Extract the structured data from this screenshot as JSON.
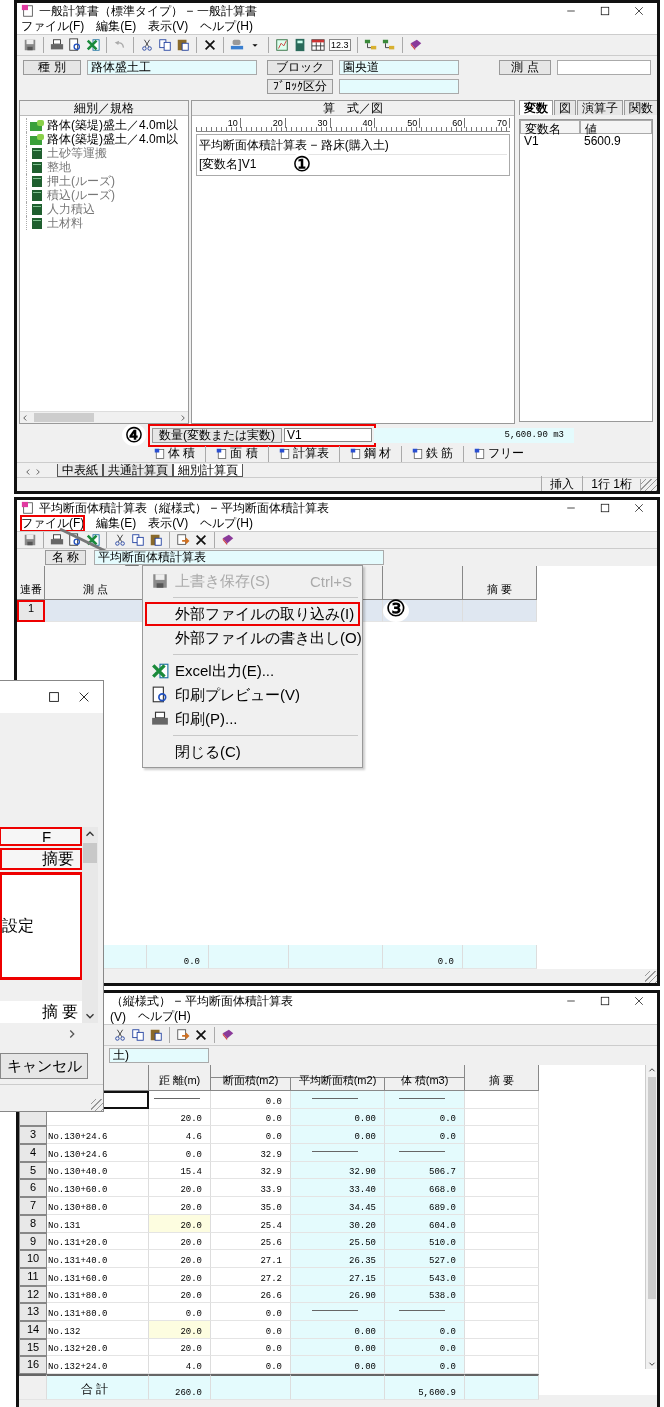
{
  "window_a": {
    "title": "一般計算書（標準タイプ） − 一般計算書",
    "menu": [
      "ファイル(F)",
      "編集(E)",
      "表示(V)",
      "ヘルプ(H)"
    ],
    "toolbar": [
      {
        "kind": "save"
      },
      {
        "kind": "sep"
      },
      {
        "kind": "print"
      },
      {
        "kind": "preview"
      },
      {
        "kind": "excel"
      },
      {
        "kind": "sep"
      },
      {
        "kind": "undo"
      },
      {
        "kind": "sep"
      },
      {
        "kind": "cut"
      },
      {
        "kind": "copy"
      },
      {
        "kind": "paste"
      },
      {
        "kind": "sep"
      },
      {
        "kind": "delete"
      },
      {
        "kind": "sep"
      },
      {
        "kind": "stamp"
      },
      {
        "kind": "caret"
      },
      {
        "kind": "sep"
      },
      {
        "kind": "chart"
      },
      {
        "kind": "calc"
      },
      {
        "kind": "grid"
      },
      {
        "kind": "label",
        "label": "12.3"
      },
      {
        "kind": "sep"
      },
      {
        "kind": "tree"
      },
      {
        "kind": "tree"
      },
      {
        "kind": "sep"
      },
      {
        "kind": "book"
      }
    ],
    "fields": [
      {
        "label": "種 別",
        "value": "路体盛土工"
      },
      {
        "label": "ブロック",
        "value": "園央道"
      },
      {
        "label": "ﾌﾞﾛｯｸ区分"
      },
      {
        "label": "測 点"
      }
    ],
    "tree_header": "細別／規格",
    "tree": [
      {
        "label": "路体(築堤)盛土／4.0m以",
        "kind": "group",
        "disabled": false
      },
      {
        "label": "路体(築堤)盛土／4.0m以",
        "kind": "group",
        "disabled": false
      },
      {
        "label": "土砂等運搬",
        "kind": "item",
        "disabled": true
      },
      {
        "label": "整地",
        "kind": "item",
        "disabled": true
      },
      {
        "label": "押土(ルーズ)",
        "kind": "item",
        "disabled": true
      },
      {
        "label": "積込(ルーズ)",
        "kind": "item",
        "disabled": true
      },
      {
        "label": "人力積込",
        "kind": "item",
        "disabled": true
      },
      {
        "label": "土材料",
        "kind": "item",
        "disabled": true
      }
    ],
    "formula_header": "算　式／図",
    "ruler_ticks": [
      "10",
      "20",
      "30",
      "40",
      "50",
      "60",
      "70"
    ],
    "formula_lines": [
      "平均断面体積計算表 − 路床(購入土)",
      "[変数名]V1"
    ],
    "formula_callout": "①",
    "side_tabs": [
      {
        "label": "変数",
        "selected": true
      },
      {
        "label": "図",
        "selected": false
      },
      {
        "label": "演算子",
        "selected": false
      },
      {
        "label": "関数",
        "selected": false
      }
    ],
    "variables": {
      "columns": [
        "変数名",
        "値"
      ],
      "rows": [
        [
          "V1",
          "5600.9"
        ]
      ]
    },
    "quantity": {
      "callout_number": "④",
      "label": "数量(変数または実数)",
      "value": "V1",
      "result": "5,600.90 m3",
      "callout": true
    },
    "insert_buttons": [
      "体 積",
      "面 積",
      "計算表",
      "鋼 材",
      "鉄 筋",
      "フリー"
    ],
    "sheet_tabs": [
      {
        "label": "中表紙",
        "selected": false
      },
      {
        "label": "共通計算頁",
        "selected": false
      },
      {
        "label": "細別計算頁",
        "selected": true
      }
    ],
    "status": [
      "挿入",
      "1行 1桁"
    ]
  },
  "window_b": {
    "title": "平均断面体積計算表（縦様式） − 平均断面体積計算表",
    "menu": [
      {
        "label": "ファイル(F)",
        "callout": true
      },
      {
        "label": "編集(E)",
        "callout": false
      },
      {
        "label": "表示(V)",
        "callout": false
      },
      {
        "label": "ヘルプ(H)",
        "callout": false
      }
    ],
    "toolbar": [
      {
        "kind": "save"
      },
      {
        "kind": "sep"
      },
      {
        "kind": "print"
      },
      {
        "kind": "preview"
      },
      {
        "kind": "excel"
      },
      {
        "kind": "sep"
      },
      {
        "kind": "cut"
      },
      {
        "kind": "copy"
      },
      {
        "kind": "paste"
      },
      {
        "kind": "sep"
      },
      {
        "kind": "import"
      },
      {
        "kind": "delete"
      },
      {
        "kind": "sep"
      },
      {
        "kind": "book"
      }
    ],
    "name_field": {
      "label": "名 称",
      "value": "平均断面体積計算表"
    },
    "columns": {
      "index": "連番",
      "station": "測 点",
      "summary": "摘 要"
    },
    "rows": [
      {
        "index": "1",
        "selected": true,
        "callout": true
      }
    ],
    "totals": {
      "distance": "0.0",
      "volume": "0.0"
    }
  },
  "file_menu": {
    "callout_number": "③",
    "items": [
      {
        "kind": "item",
        "label": "上書き保存(S)",
        "shortcut": "Ctrl+S",
        "disabled": true,
        "callout": false
      },
      {
        "kind": "separator"
      },
      {
        "kind": "item",
        "label": "外部ファイルの取り込み(I)",
        "disabled": false,
        "callout": true
      },
      {
        "kind": "item",
        "label": "外部ファイルの書き出し(O)",
        "disabled": false,
        "callout": false
      },
      {
        "kind": "separator"
      },
      {
        "kind": "item",
        "label": "Excel出力(E)...",
        "disabled": false,
        "callout": false
      },
      {
        "kind": "item",
        "label": "印刷プレビュー(V)",
        "disabled": false,
        "callout": false
      },
      {
        "kind": "item",
        "label": "印刷(P)...",
        "disabled": false,
        "callout": false
      },
      {
        "kind": "separator"
      },
      {
        "kind": "item",
        "label": "閉じる(C)",
        "disabled": false,
        "callout": false
      }
    ]
  },
  "dialog": {
    "header": "F",
    "header_callout": true,
    "subheader": "摘要",
    "subheader_callout": true,
    "body_text": "設定",
    "body_callout": true,
    "row_label": "摘 要",
    "button": "キャンセル"
  },
  "window_c": {
    "title": "（縦様式） − 平均断面体積計算表",
    "menu": [
      "(V)",
      "ヘルプ(H)"
    ],
    "toolbar": [
      {
        "kind": "cut"
      },
      {
        "kind": "copy"
      },
      {
        "kind": "paste"
      },
      {
        "kind": "sep"
      },
      {
        "kind": "import"
      },
      {
        "kind": "delete"
      },
      {
        "kind": "sep"
      },
      {
        "kind": "book"
      }
    ],
    "name_value": "土)",
    "columns": {
      "distance": "距 離(m)",
      "area": "断面積(m2)",
      "avg_area": "平均断面積(m2)",
      "volume": "体 積(m3)",
      "summary": "摘 要"
    },
    "rows": [
      {
        "active": true,
        "distance": null,
        "area": "0.0",
        "avg_area": null,
        "volume": null,
        "highlight": false
      },
      {
        "active": false,
        "distance": "20.0",
        "area": "0.0",
        "avg_area": "0.00",
        "volume": "0.0",
        "highlight": false
      },
      {
        "active": false,
        "index": "3",
        "station": "No.130+24.6",
        "distance": "4.6",
        "area": "0.0",
        "avg_area": "0.00",
        "volume": "0.0",
        "highlight": false
      },
      {
        "active": false,
        "index": "4",
        "station": "No.130+24.6",
        "distance": "0.0",
        "area": "32.9",
        "avg_area": null,
        "volume": null,
        "highlight": false
      },
      {
        "active": false,
        "index": "5",
        "station": "No.130+40.0",
        "distance": "15.4",
        "area": "32.9",
        "avg_area": "32.90",
        "volume": "506.7",
        "highlight": false
      },
      {
        "active": false,
        "index": "6",
        "station": "No.130+60.0",
        "distance": "20.0",
        "area": "33.9",
        "avg_area": "33.40",
        "volume": "668.0",
        "highlight": false
      },
      {
        "active": false,
        "index": "7",
        "station": "No.130+80.0",
        "distance": "20.0",
        "area": "35.0",
        "avg_area": "34.45",
        "volume": "689.0",
        "highlight": false
      },
      {
        "active": false,
        "index": "8",
        "station": "No.131",
        "distance": "20.0",
        "area": "25.4",
        "avg_area": "30.20",
        "volume": "604.0",
        "highlight": true
      },
      {
        "active": false,
        "index": "9",
        "station": "No.131+20.0",
        "distance": "20.0",
        "area": "25.6",
        "avg_area": "25.50",
        "volume": "510.0",
        "highlight": false
      },
      {
        "active": false,
        "index": "10",
        "station": "No.131+40.0",
        "distance": "20.0",
        "area": "27.1",
        "avg_area": "26.35",
        "volume": "527.0",
        "highlight": false
      },
      {
        "active": false,
        "index": "11",
        "station": "No.131+60.0",
        "distance": "20.0",
        "area": "27.2",
        "avg_area": "27.15",
        "volume": "543.0",
        "highlight": false
      },
      {
        "active": false,
        "index": "12",
        "station": "No.131+80.0",
        "distance": "20.0",
        "area": "26.6",
        "avg_area": "26.90",
        "volume": "538.0",
        "highlight": false
      },
      {
        "active": false,
        "index": "13",
        "station": "No.131+80.0",
        "distance": "0.0",
        "area": "0.0",
        "avg_area": null,
        "volume": null,
        "highlight": false
      },
      {
        "active": false,
        "index": "14",
        "station": "No.132",
        "distance": "20.0",
        "area": "0.0",
        "avg_area": "0.00",
        "volume": "0.0",
        "highlight": true
      },
      {
        "active": false,
        "index": "15",
        "station": "No.132+20.0",
        "distance": "20.0",
        "area": "0.0",
        "avg_area": "0.00",
        "volume": "0.0",
        "highlight": false
      },
      {
        "active": false,
        "index": "16",
        "station": "No.132+24.0",
        "distance": "4.0",
        "area": "0.0",
        "avg_area": "0.00",
        "volume": "0.0",
        "highlight": false
      }
    ],
    "totals": {
      "label": "合 計",
      "distance": "260.0",
      "volume": "5,600.9"
    }
  }
}
